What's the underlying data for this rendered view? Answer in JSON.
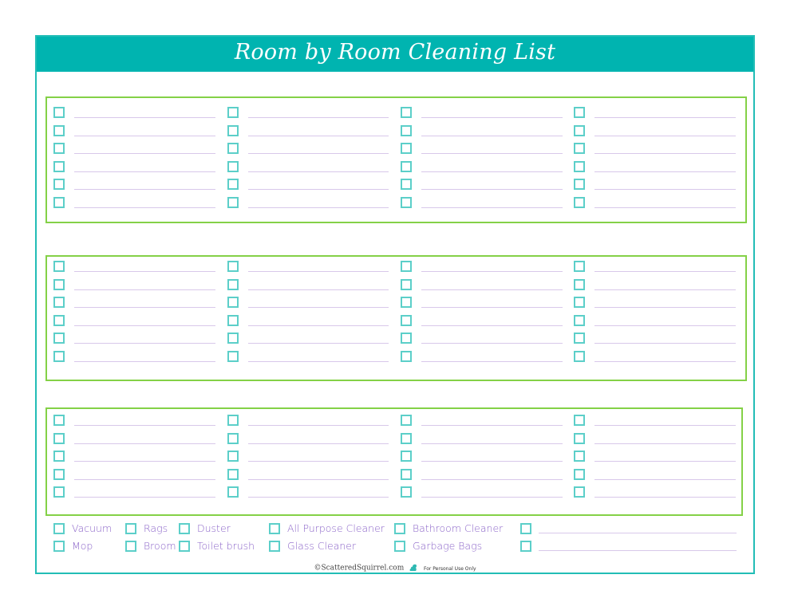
{
  "title": "Room by Room Cleaning List",
  "colors": {
    "header_bg": "#00b4b0",
    "frame_border": "#22bdb6",
    "section_border": "#84d147",
    "checkbox_border": "#5ccfc9",
    "line_color": "#d8c8ea",
    "supply_text": "#8a63c8"
  },
  "sections": [
    {
      "name": "section-1",
      "columns": 4,
      "rows_per_column": 6
    },
    {
      "name": "section-2",
      "columns": 4,
      "rows_per_column": 6
    },
    {
      "name": "section-3",
      "columns": 4,
      "rows_per_column": 5
    }
  ],
  "supplies": {
    "row1": [
      "Vacuum",
      "Rags",
      "Duster",
      "All Purpose Cleaner",
      "Bathroom Cleaner"
    ],
    "row2": [
      "Mop",
      "Broom",
      "Toilet brush",
      "Glass Cleaner",
      "Garbage Bags"
    ],
    "blank_items": 2
  },
  "footer": {
    "copyright": "©ScatteredSquirrel.com",
    "icon": "squirrel-icon",
    "note": "For Personal Use Only"
  }
}
